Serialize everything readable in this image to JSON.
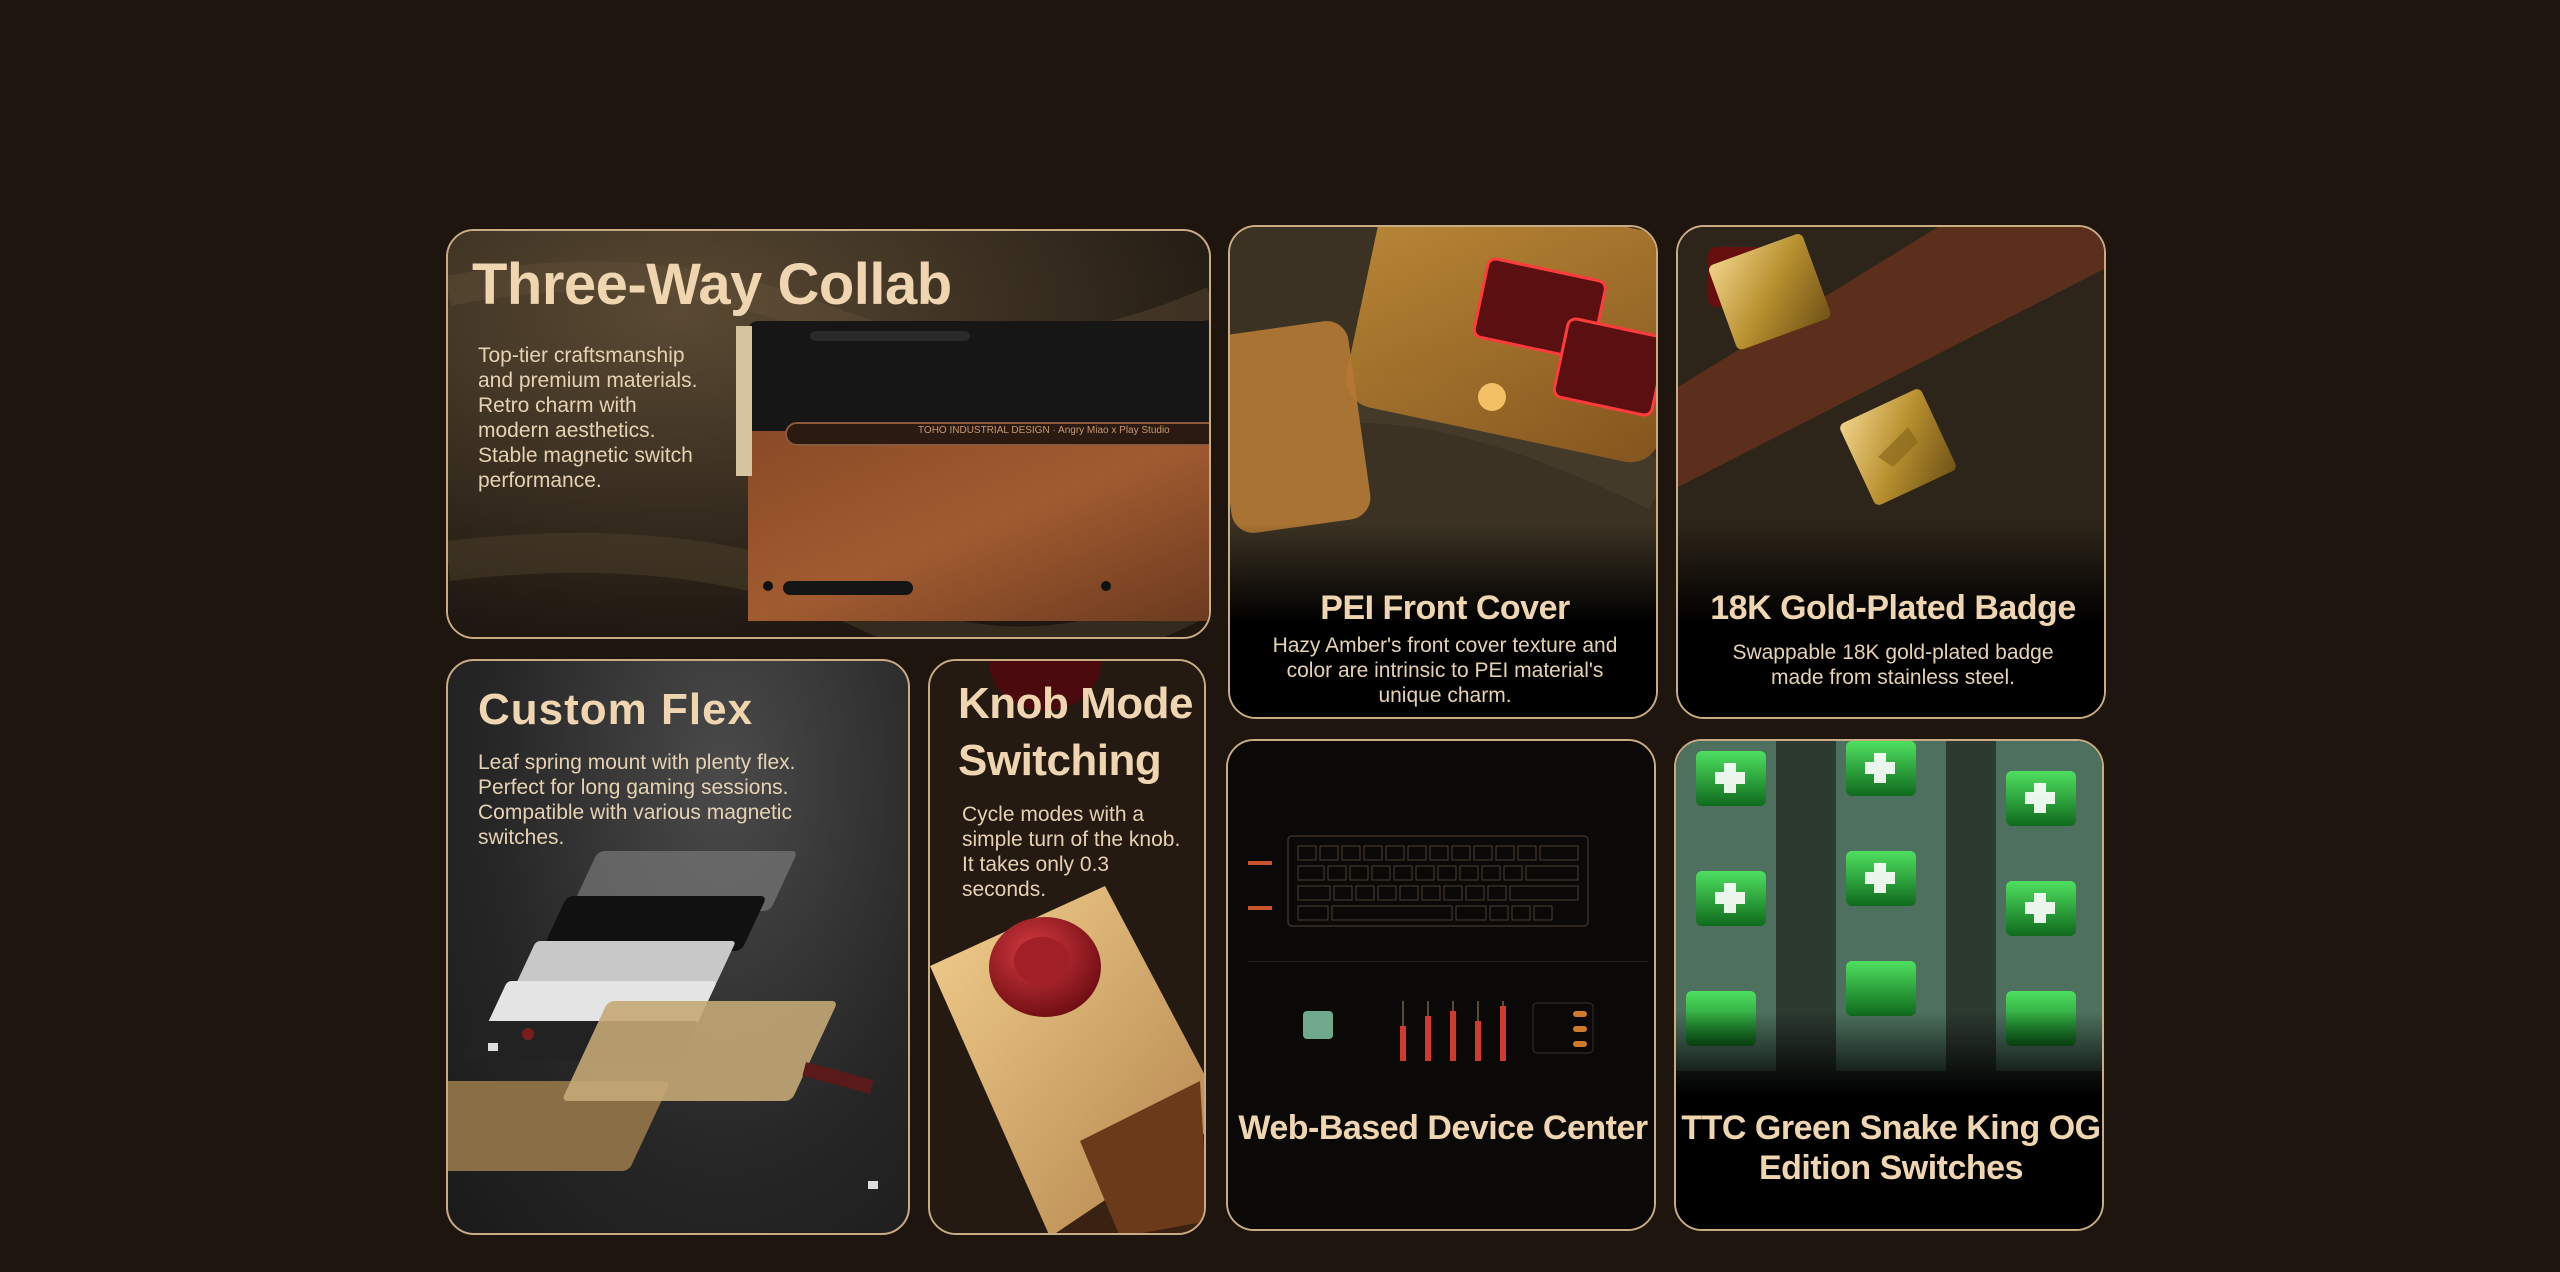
{
  "cards": {
    "collab": {
      "title": "Three-Way Collab",
      "desc": "Top-tier craftsmanship and premium materials. Retro charm with modern aesthetics. Stable magnetic switch performance.",
      "engraving": "TOHO INDUSTRIAL DESIGN · Angry Miao x Play Studio"
    },
    "pei": {
      "title": "PEI Front Cover",
      "desc": "Hazy Amber's front cover texture and color are intrinsic to PEI material's unique charm."
    },
    "badge": {
      "title": "18K Gold-Plated Badge",
      "desc": "Swappable 18K gold-plated badge made from stainless steel."
    },
    "flex": {
      "title": "Custom Flex",
      "desc": "Leaf spring mount with plenty flex. Perfect for long gaming sessions. Compatible with various magnetic switches."
    },
    "knob": {
      "title_line1": "Knob Mode",
      "title_line2": "Switching",
      "desc": "Cycle modes with a simple turn of the knob. It takes only 0.3 seconds."
    },
    "web": {
      "title": "Web-Based Device Center"
    },
    "ttc": {
      "title_line1": "TTC Green Snake King OG",
      "title_line2": "Edition Switches"
    }
  },
  "colors": {
    "background": "#1e150e",
    "border": "#c9ab84",
    "title": "#efd6b1",
    "text": "#e6d2b3"
  }
}
